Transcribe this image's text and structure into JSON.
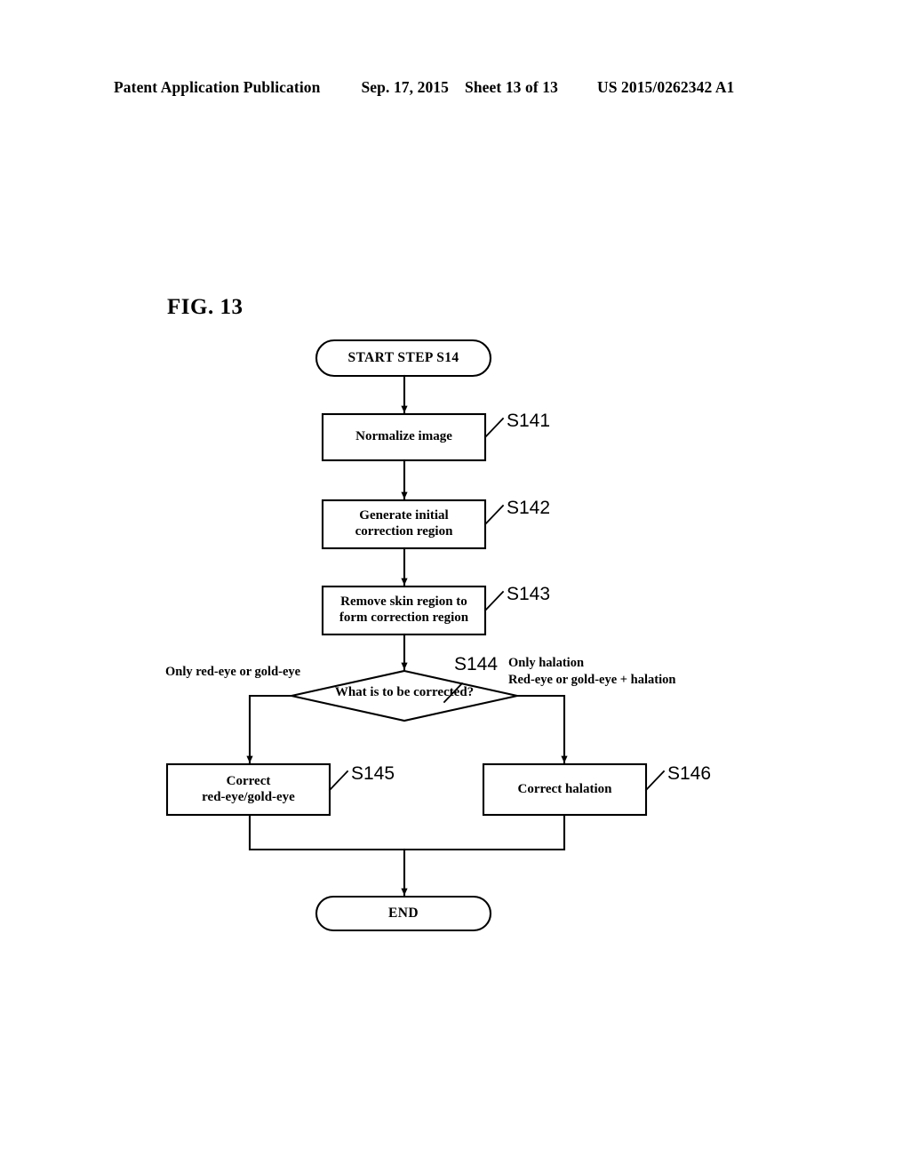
{
  "header": {
    "publication": "Patent Application Publication",
    "date": "Sep. 17, 2015",
    "sheet": "Sheet 13 of 13",
    "patent_number": "US 2015/0262342 A1"
  },
  "figure": {
    "label": "FIG. 13"
  },
  "flowchart": {
    "start": {
      "label": "START STEP S14"
    },
    "end": {
      "label": "END"
    },
    "steps": [
      {
        "tag": "S141",
        "label": "Normalize image"
      },
      {
        "tag": "S142",
        "label": "Generate initial\ncorrection region"
      },
      {
        "tag": "S143",
        "label": "Remove skin region to\nform correction region"
      },
      {
        "tag": "S144",
        "label": "What is to be corrected?"
      },
      {
        "tag": "S145",
        "label": "Correct\nred-eye/gold-eye"
      },
      {
        "tag": "S146",
        "label": "Correct halation"
      }
    ],
    "step_tags": {
      "s141": "S141",
      "s142": "S142",
      "s143": "S143",
      "s144": "S144",
      "s145": "S145",
      "s146": "S146"
    },
    "node_labels": {
      "normalize": "Normalize image",
      "generate_l1": "Generate initial",
      "generate_l2": "correction region",
      "remove_l1": "Remove skin region to",
      "remove_l2": "form correction region",
      "decision": "What is to be corrected?",
      "correct_rg_l1": "Correct",
      "correct_rg_l2": "red-eye/gold-eye",
      "correct_halation": "Correct halation"
    },
    "branches": {
      "left": "Only red-eye or gold-eye",
      "right_line1": "Only halation",
      "right_line2": "Red-eye or gold-eye + halation"
    }
  },
  "colors": {
    "ink": "#000000",
    "page": "#ffffff"
  }
}
